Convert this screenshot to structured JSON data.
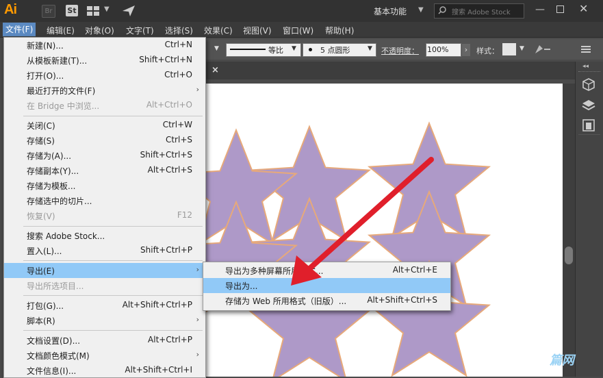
{
  "app": {
    "logo_text": "Ai",
    "bridge_badge": "Br",
    "stock_badge": "St",
    "workspace": "基本功能",
    "search_placeholder": "搜索 Adobe Stock"
  },
  "menubar": [
    {
      "label": "文件(F)"
    },
    {
      "label": "编辑(E)"
    },
    {
      "label": "对象(O)"
    },
    {
      "label": "文字(T)"
    },
    {
      "label": "选择(S)"
    },
    {
      "label": "效果(C)"
    },
    {
      "label": "视图(V)"
    },
    {
      "label": "窗口(W)"
    },
    {
      "label": "帮助(H)"
    }
  ],
  "controlbar": {
    "stroke_profile": "等比",
    "brush": "5 点圆形",
    "opacity_label": "不透明度：",
    "opacity_value": "100%",
    "style_label": "样式："
  },
  "file_menu": [
    {
      "label": "新建(N)...",
      "shortcut": "Ctrl+N"
    },
    {
      "label": "从模板新建(T)...",
      "shortcut": "Shift+Ctrl+N"
    },
    {
      "label": "打开(O)...",
      "shortcut": "Ctrl+O"
    },
    {
      "label": "最近打开的文件(F)",
      "shortcut": "",
      "submenu": true
    },
    {
      "label": "在 Bridge 中浏览...",
      "shortcut": "Alt+Ctrl+O",
      "disabled": true
    },
    {
      "label": "关闭(C)",
      "shortcut": "Ctrl+W"
    },
    {
      "label": "存储(S)",
      "shortcut": "Ctrl+S"
    },
    {
      "label": "存储为(A)...",
      "shortcut": "Shift+Ctrl+S"
    },
    {
      "label": "存储副本(Y)...",
      "shortcut": "Alt+Ctrl+S"
    },
    {
      "label": "存储为模板...",
      "shortcut": ""
    },
    {
      "label": "存储选中的切片...",
      "shortcut": ""
    },
    {
      "label": "恢复(V)",
      "shortcut": "F12",
      "disabled": true
    },
    {
      "label": "搜索 Adobe Stock...",
      "shortcut": ""
    },
    {
      "label": "置入(L)...",
      "shortcut": "Shift+Ctrl+P"
    },
    {
      "label": "导出(E)",
      "shortcut": "",
      "submenu": true,
      "highlighted": true
    },
    {
      "label": "导出所选项目...",
      "shortcut": "",
      "disabled": true
    },
    {
      "label": "打包(G)...",
      "shortcut": "Alt+Shift+Ctrl+P"
    },
    {
      "label": "脚本(R)",
      "shortcut": "",
      "submenu": true
    },
    {
      "label": "文档设置(D)...",
      "shortcut": "Alt+Ctrl+P"
    },
    {
      "label": "文档颜色模式(M)",
      "shortcut": "",
      "submenu": true
    },
    {
      "label": "文件信息(I)...",
      "shortcut": "Alt+Shift+Ctrl+I"
    }
  ],
  "export_submenu": [
    {
      "label": "导出为多种屏幕所用格式...",
      "shortcut": "Alt+Ctrl+E"
    },
    {
      "label": "导出为...",
      "shortcut": "",
      "highlighted": true
    },
    {
      "label": "存储为 Web 所用格式（旧版）...",
      "shortcut": "Alt+Shift+Ctrl+S"
    }
  ],
  "colors": {
    "star_fill": "#ae99c8",
    "star_stroke": "#e7a97a",
    "arrow": "#e01f2b",
    "menu_highlight": "#91c9f7"
  },
  "watermark": "篇网"
}
